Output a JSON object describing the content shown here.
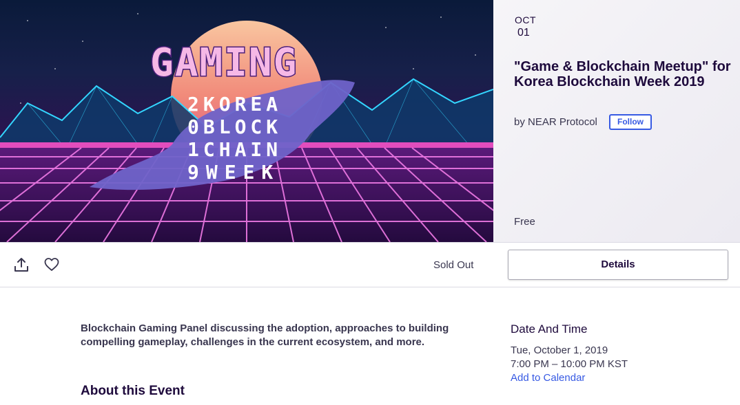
{
  "hero": {
    "image_title": "GAMING",
    "lines": [
      "2KOREA",
      "0BLOCK",
      "1CHAIN",
      "9WEEK"
    ]
  },
  "event": {
    "month": "OCT",
    "day": "01",
    "title": "\"Game & Blockchain Meetup\" for Korea Blockchain Week 2019",
    "organizer": "by NEAR Protocol",
    "follow_label": "Follow",
    "price": "Free"
  },
  "actions": {
    "share_icon": "share-icon",
    "like_icon": "heart-icon",
    "status": "Sold Out",
    "details_label": "Details"
  },
  "content": {
    "summary": "Blockchain Gaming Panel discussing the adoption, approaches to building compelling gameplay, challenges in the current ecosystem, and more.",
    "about_heading": "About this Event"
  },
  "datetime": {
    "heading": "Date And Time",
    "date": "Tue, October 1, 2019",
    "time": "7:00 PM – 10:00 PM KST",
    "calendar_link": "Add to Calendar"
  },
  "colors": {
    "accent": "#3659e3",
    "text_dark": "#1e0a3c",
    "text_body": "#39364f"
  }
}
